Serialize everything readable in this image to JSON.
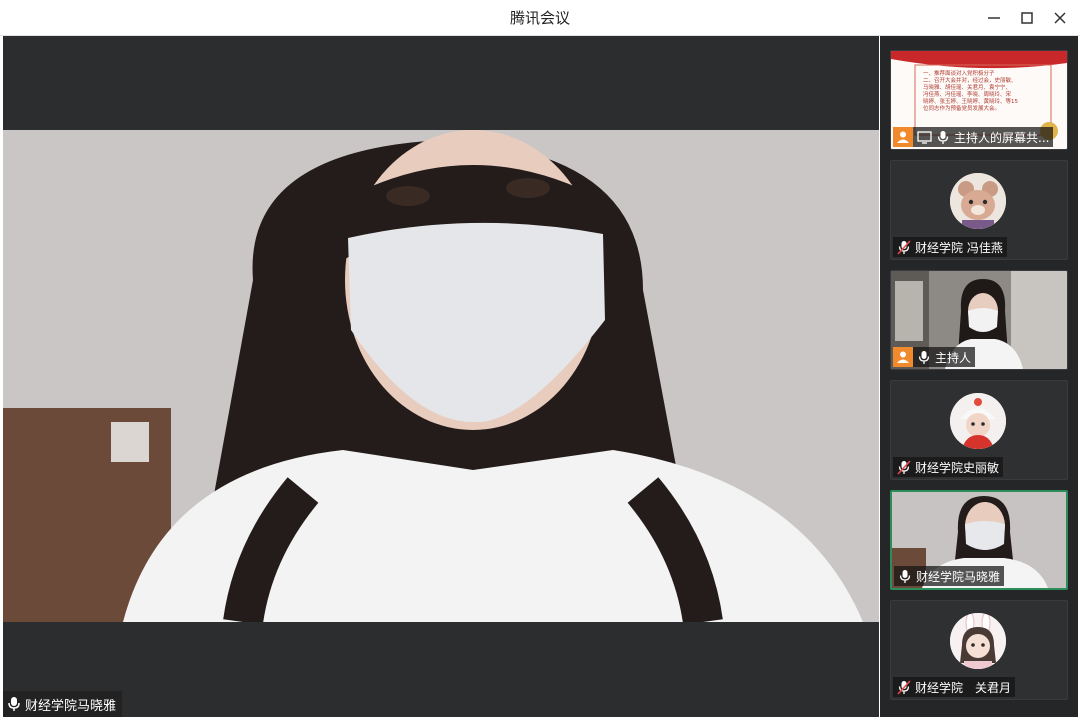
{
  "window": {
    "title": "腾讯会议"
  },
  "main": {
    "speaker_name": "财经学院马晓雅"
  },
  "slide": {
    "lines": [
      "一、推荐面谈对入党积极分子",
      "二、召开大会并对，经过会，史丽敏、",
      "马晓雅、胡佳瑶、关君月、袁宁宁、",
      "冯佳燕、冯佳瑶、李晓、周晓玲、宋",
      "晓婷、张玉婷、王晓婷、黄晓玲、等15",
      "位同志作为预备党员发展大会。"
    ]
  },
  "participants": [
    {
      "name": "主持人的屏幕共...",
      "kind": "screen-share",
      "host": true
    },
    {
      "name": "财经学院 冯佳燕",
      "kind": "avatar-bear",
      "muted": true
    },
    {
      "name": "主持人",
      "kind": "camera",
      "host": true
    },
    {
      "name": "财经学院史丽敏",
      "kind": "avatar-girl",
      "muted": true
    },
    {
      "name": "财经学院马晓雅",
      "kind": "camera",
      "active": true
    },
    {
      "name": "财经学院　关君月",
      "kind": "avatar-bunny",
      "muted": true
    }
  ],
  "colors": {
    "host_badge": "#f08a2c",
    "active_border": "#2c8d5a"
  }
}
